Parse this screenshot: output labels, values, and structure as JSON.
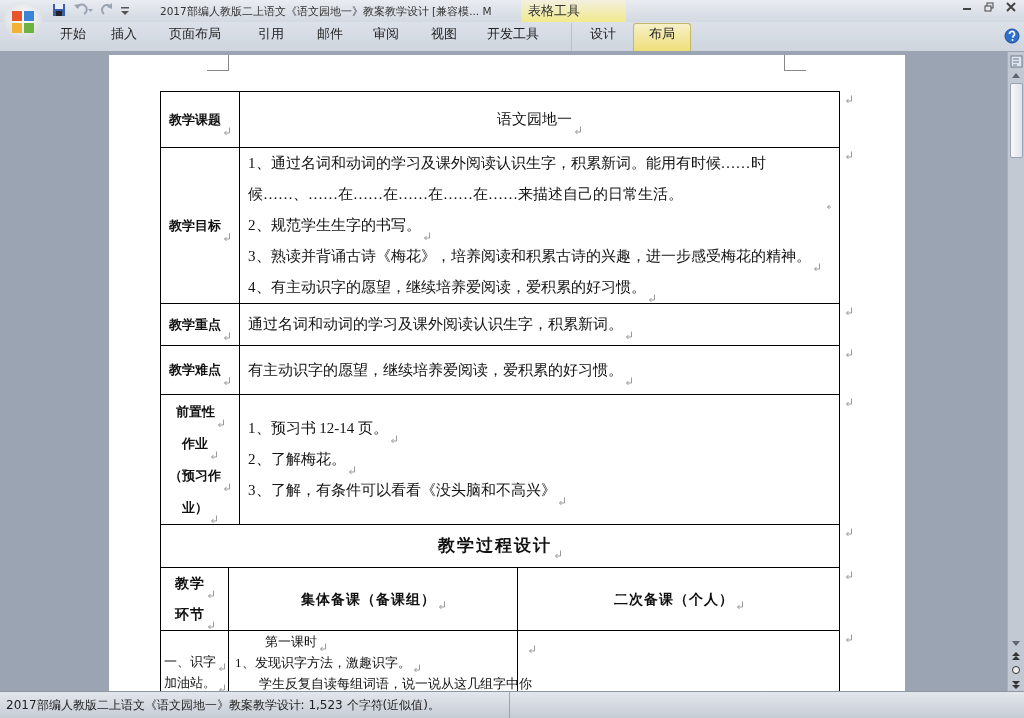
{
  "window": {
    "title": "2017部编人教版二上语文《语文园地一》教案教学设计 [兼容模... M",
    "context_group": "表格工具"
  },
  "ribbon_tabs": [
    {
      "label": "开始",
      "selected": false
    },
    {
      "label": "插入",
      "selected": false
    },
    {
      "label": "页面布局",
      "selected": false
    },
    {
      "label": "引用",
      "selected": false
    },
    {
      "label": "邮件",
      "selected": false
    },
    {
      "label": "审阅",
      "selected": false
    },
    {
      "label": "视图",
      "selected": false
    },
    {
      "label": "开发工具",
      "selected": false
    }
  ],
  "table_tools_tabs": [
    {
      "label": "设计",
      "selected": false
    },
    {
      "label": "布局",
      "selected": true
    }
  ],
  "document": {
    "info_rows": [
      {
        "kind": "title",
        "label": [
          "教学课题"
        ],
        "lines": [
          "语文园地一"
        ]
      },
      {
        "kind": "list",
        "label": [
          "教学目标"
        ],
        "lines": [
          "1、通过名词和动词的学习及课外阅读认识生字，积累新词。能用有时候……时候……、……在……在……在……在……来描述自己的日常生活。",
          "2、规范学生生字的书写。",
          "3、熟读并背诵古诗《梅花》，培养阅读和积累古诗的兴趣，进一步感受梅花的精神。",
          "4、有主动识字的愿望，继续培养爱阅读，爱积累的好习惯。"
        ]
      },
      {
        "kind": "list",
        "label": [
          "教学重点"
        ],
        "lines": [
          "通过名词和动词的学习及课外阅读认识生字，积累新词。"
        ]
      },
      {
        "kind": "list",
        "label": [
          "教学难点"
        ],
        "lines": [
          "有主动识字的愿望，继续培养爱阅读，爱积累的好习惯。"
        ]
      },
      {
        "kind": "list",
        "label": [
          "前置性",
          "作业",
          "（预习作",
          "业）"
        ],
        "lines": [
          "1、预习书 12-14 页。",
          "2、了解梅花。",
          "3、了解，有条件可以看看《没头脑和不高兴》"
        ]
      }
    ],
    "process_title": "教学过程设计",
    "process_headers": [
      [
        "教学",
        "环节"
      ],
      [
        "集体备课（备课组）"
      ],
      [
        "二次备课（个人）"
      ]
    ],
    "process_rows": [
      {
        "stage": [
          "一、识字",
          "加油站。"
        ],
        "group": [
          {
            "kind": "heading",
            "text": "第一课时"
          },
          {
            "kind": "item",
            "text": "1、发现识字方法，激趣识字。"
          },
          {
            "kind": "indent",
            "text": "学生反复自读每组词语，说一说从这几组字中你"
          }
        ]
      }
    ]
  },
  "status_bar": "2017部编人教版二上语文《语文园地一》教案教学设计: 1,523 个字符(近似值)。"
}
